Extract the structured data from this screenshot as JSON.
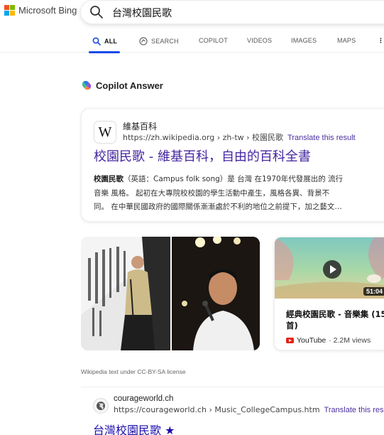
{
  "brand": {
    "name": "Microsoft Bing",
    "colors": [
      "#f25022",
      "#7fba00",
      "#00a4ef",
      "#ffb900"
    ]
  },
  "search": {
    "query": "台灣校園民歌"
  },
  "tabs": [
    {
      "label": "ALL",
      "active": true
    },
    {
      "label": "SEARCH"
    },
    {
      "label": "COPILOT"
    },
    {
      "label": "VIDEOS"
    },
    {
      "label": "IMAGES"
    },
    {
      "label": "MAPS"
    }
  ],
  "copilot": {
    "title": "Copilot Answer"
  },
  "wiki_result": {
    "icon_letter": "W",
    "site_name": "維基百科",
    "url": "https://zh.wikipedia.org › zh-tw › 校園民歌",
    "translate": "Translate this result",
    "title": "校園民歌 - 維基百科，自由的百科全書",
    "snippet_lines": [
      {
        "bold": "校園民歌",
        "text": "（英語：Campus folk song）是 台灣 在1970年代發展出的 流行"
      },
      {
        "bold": "",
        "text": "音樂 風格。 起初在大專院校校園的學生活動中產生，風格各異、背景不"
      },
      {
        "bold": "",
        "text": "同。 在中華民國政府的國際關係漸漸處於不利的地位之前提下，加之藝文…"
      }
    ]
  },
  "video": {
    "duration": "51:04",
    "title": "經典校園民歌 - 音樂集 (15首)",
    "source": "YouTube",
    "views": "· 2.2M views"
  },
  "license": "Wikipedia text under CC-BY-SA license",
  "result2": {
    "site_name": "courageworld.ch",
    "url": "https://courageworld.ch › Music_CollegeCampus.htm",
    "translate": "Translate this result",
    "title": "台灣校園民歌 ★"
  },
  "accent": "#174ae4",
  "link_color": "#4527a0"
}
